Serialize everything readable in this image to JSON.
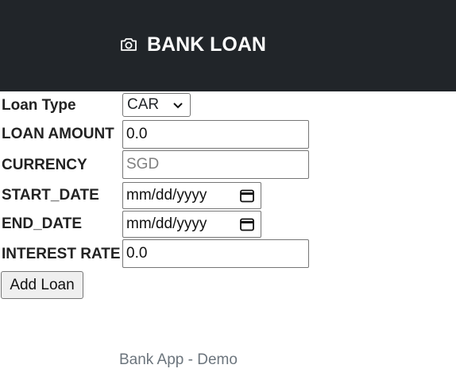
{
  "header": {
    "title": "BANK LOAN",
    "icon": "camera-icon"
  },
  "form": {
    "loan_type": {
      "label": "Loan Type",
      "value": "CAR"
    },
    "loan_amount": {
      "label": "LOAN AMOUNT",
      "value": "0.0"
    },
    "currency": {
      "label": "CURRENCY",
      "placeholder": "SGD"
    },
    "start_date": {
      "label": "START_DATE",
      "placeholder": "mm/dd/yyyy"
    },
    "end_date": {
      "label": "END_DATE",
      "placeholder": "mm/dd/yyyy"
    },
    "interest_rate": {
      "label": "INTEREST RATE",
      "value": "0.0"
    },
    "submit_label": "Add Loan"
  },
  "footer": {
    "text": "Bank App - Demo"
  },
  "colors": {
    "navbar": "#212529",
    "footer_text": "#6c757d"
  }
}
